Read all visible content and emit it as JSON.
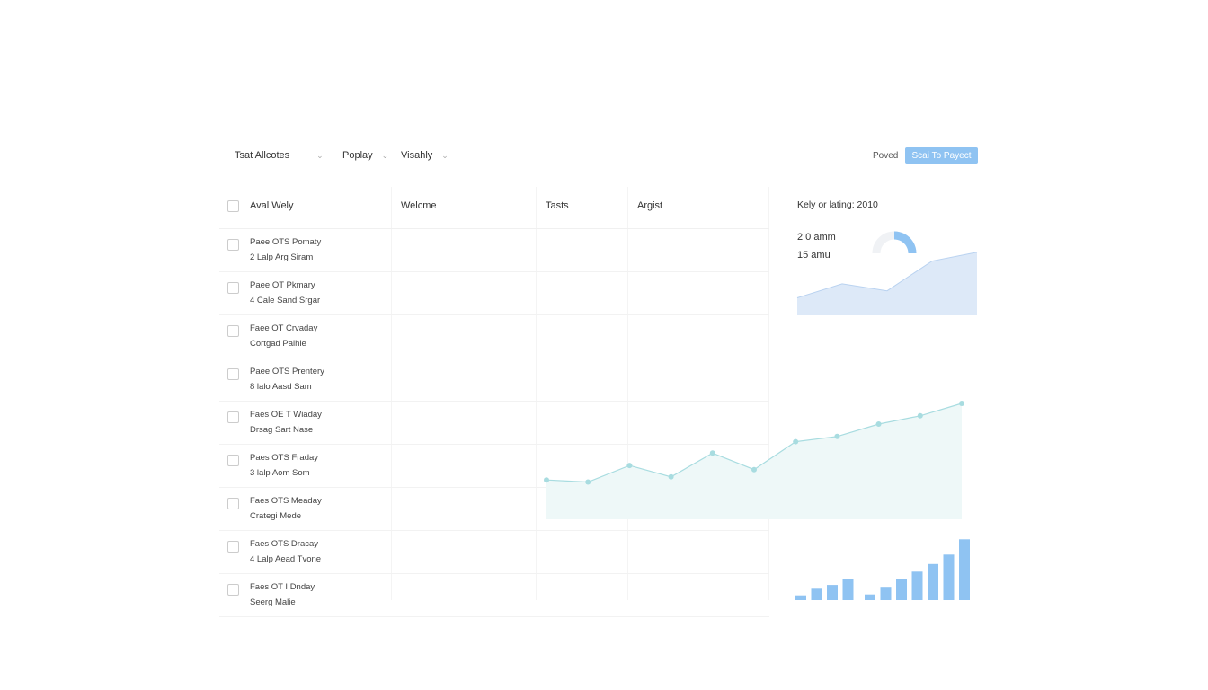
{
  "toolbar": {
    "filters": [
      {
        "label": "Tsat Allcotes"
      },
      {
        "label": "Poplay"
      },
      {
        "label": "Visahly"
      }
    ],
    "chevron_glyph": "⌄",
    "secondary_label": "Poved",
    "primary_button_label": "Scai To Payect"
  },
  "table": {
    "columns": [
      "Aval Wely",
      "Welcme",
      "Tasts",
      "Argist"
    ],
    "rows": [
      {
        "line1": "Paee OTS Pomaty",
        "line2": "2 Lalp Arg Siram"
      },
      {
        "line1": "Paee OT Pkmary",
        "line2": "4 Cale Sand Srgar"
      },
      {
        "line1": "Faee OT Crvaday",
        "line2": "Cortgad Palhie"
      },
      {
        "line1": "Paee OTS Prentery",
        "line2": "8 lalo Aasd Sam"
      },
      {
        "line1": "Faes OE T Wiaday",
        "line2": "Drsag Sart Nase"
      },
      {
        "line1": "Paes OTS Fraday",
        "line2": "3 lalp Aom Som"
      },
      {
        "line1": "Faes OTS Meaday",
        "line2": "Crategi Mede"
      },
      {
        "line1": "Faes OTS Dracay",
        "line2": "4 Lalp Aead Tvone"
      },
      {
        "line1": "Faes OT I Dnday",
        "line2": "Seerg Malie"
      }
    ]
  },
  "widget": {
    "title": "Kely or lating: 2010",
    "stat1": "2 0 amm",
    "stat2": "15 amu",
    "donut_fraction": 0.33,
    "area_values": [
      20,
      36,
      28,
      62,
      72
    ]
  },
  "chart_data": [
    {
      "type": "area",
      "x": [
        1,
        2,
        3,
        4,
        5,
        6,
        7,
        8,
        9,
        10,
        11
      ],
      "values": [
        38,
        36,
        52,
        41,
        64,
        48,
        75,
        80,
        92,
        100,
        112
      ],
      "ylim": [
        0,
        125
      ],
      "xlim": [
        1,
        11
      ],
      "grid": false,
      "color": "#a8dce0"
    },
    {
      "type": "bar",
      "series": [
        {
          "values": [
            5,
            12,
            16,
            22
          ]
        },
        {
          "values": [
            6,
            14,
            22,
            30,
            38,
            48,
            64
          ]
        }
      ],
      "ylim": [
        0,
        70
      ],
      "grid": false,
      "color": "#8fc3f2"
    }
  ],
  "colors": {
    "accent": "#8fc3f2",
    "area_fill": "#dde9f8",
    "teal_line": "#a8dce0"
  }
}
